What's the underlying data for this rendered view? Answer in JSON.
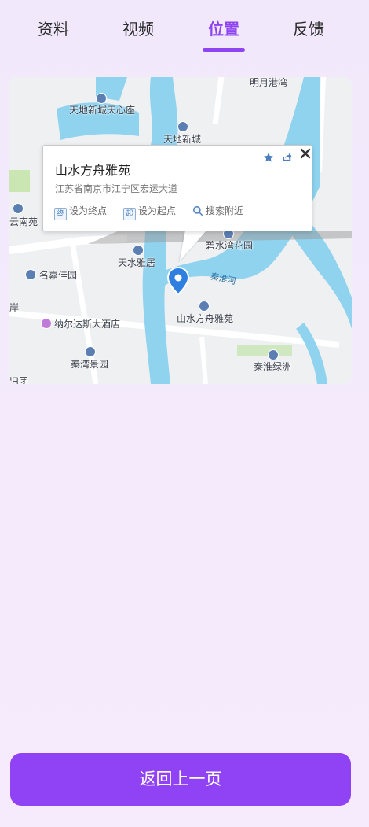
{
  "tabs": [
    {
      "label": "资料",
      "active": false
    },
    {
      "label": "视频",
      "active": false
    },
    {
      "label": "位置",
      "active": true
    },
    {
      "label": "反馈",
      "active": false
    }
  ],
  "map": {
    "pois": {
      "mingyue": "明月港湾",
      "tiandi_center": "天地新城天心座",
      "tiandi": "天地新城",
      "yunnan": "云南苑",
      "bishui": "碧水湾花园",
      "tianshui": "天水雅居",
      "mingjia": "名嘉佳园",
      "shanshui": "山水方舟雅苑",
      "nuoer": "纳尔达斯大酒店",
      "qinwan": "秦湾景园",
      "qinhuai_lvzhou": "秦淮绿洲",
      "edge_left": "岸",
      "edge_bottom": "旧团"
    },
    "river_label": "秦淮河"
  },
  "info_window": {
    "title": "山水方舟雅苑",
    "address": "江苏省南京市江宁区宏运大道",
    "actions": [
      {
        "icon_text": "终",
        "label": "设为终点"
      },
      {
        "icon_text": "起",
        "label": "设为起点"
      },
      {
        "icon_text": "",
        "label": "搜索附近"
      }
    ]
  },
  "back_button": {
    "label": "返回上一页"
  },
  "colors": {
    "accent": "#8e44f0",
    "button": "#9043f5",
    "water": "#8fd3ef"
  }
}
